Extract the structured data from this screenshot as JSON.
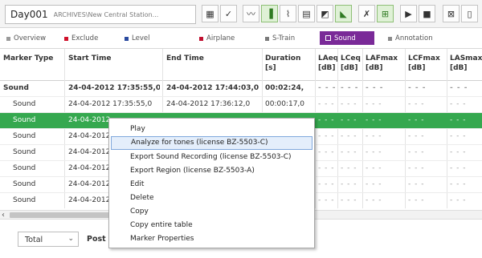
{
  "header": {
    "project_name": "Day001",
    "project_path": "ARCHIVES\\New Central Station...",
    "tools_left": [
      "bookmark-add-icon",
      "filter-check-icon"
    ],
    "tools_mid": [
      "chart-line-icon",
      "chart-bar-icon",
      "chart-mixed-icon",
      "table-icon",
      "map-icon",
      "chart-area-icon"
    ],
    "tools_right": [
      "event-icon",
      "grid-icon"
    ],
    "tools_playback": [
      "play-icon",
      "stop-icon"
    ],
    "tools_end": [
      "window-icon",
      "panel-icon"
    ]
  },
  "filters": [
    {
      "label": "Overview",
      "color": "#9a9a9a"
    },
    {
      "label": "Exclude",
      "color": "#d0112b"
    },
    {
      "label": "Level",
      "color": "#2a4a9f"
    },
    {
      "label": "Airplane",
      "color": "#c01030"
    },
    {
      "label": "S-Train",
      "color": "#7a7a7a"
    },
    {
      "label": "Sound",
      "color": "#7a2a98"
    },
    {
      "label": "Annotation",
      "color": "#8a8a8a"
    }
  ],
  "table": {
    "columns": [
      {
        "label": "Marker Type",
        "unit": ""
      },
      {
        "label": "Start Time",
        "unit": ""
      },
      {
        "label": "End Time",
        "unit": ""
      },
      {
        "label": "Duration",
        "unit": "[s]"
      },
      {
        "label": "LAeq",
        "unit": "[dB]"
      },
      {
        "label": "LCeq",
        "unit": "[dB]"
      },
      {
        "label": "LAFmax",
        "unit": "[dB]"
      },
      {
        "label": "LCFmax",
        "unit": "[dB]"
      },
      {
        "label": "LASmax",
        "unit": "[dB]"
      }
    ],
    "rows": [
      {
        "type": "Sound",
        "start": "24-04-2012 17:35:55,0",
        "end": "24-04-2012 17:44:03,0",
        "duration": "00:02:24,",
        "laeq": "- - -",
        "lceq": "- - -",
        "lafmax": "- - -",
        "lcfmax": "- - -",
        "lasmax": "- - -"
      },
      {
        "type": "Sound",
        "start": "24-04-2012 17:35:55,0",
        "end": "24-04-2012 17:36:12,0",
        "duration": "00:00:17,0",
        "laeq": "- - -",
        "lceq": "- - -",
        "lafmax": "- - -",
        "lcfmax": "- - -",
        "lasmax": "- - -"
      },
      {
        "type": "Sound",
        "start": "24-04-2012",
        "end": "",
        "duration": "",
        "laeq": "- - -",
        "lceq": "- - -",
        "lafmax": "- - -",
        "lcfmax": "- - -",
        "lasmax": "- - -"
      },
      {
        "type": "Sound",
        "start": "24-04-2012",
        "end": "",
        "duration": "",
        "laeq": "- - -",
        "lceq": "- - -",
        "lafmax": "- - -",
        "lcfmax": "- - -",
        "lasmax": "- - -"
      },
      {
        "type": "Sound",
        "start": "24-04-2012",
        "end": "",
        "duration": "",
        "laeq": "- - -",
        "lceq": "- - -",
        "lafmax": "- - -",
        "lcfmax": "- - -",
        "lasmax": "- - -"
      },
      {
        "type": "Sound",
        "start": "24-04-2012",
        "end": "",
        "duration": "",
        "laeq": "- - -",
        "lceq": "- - -",
        "lafmax": "- - -",
        "lcfmax": "- - -",
        "lasmax": "- - -"
      },
      {
        "type": "Sound",
        "start": "24-04-2012",
        "end": "",
        "duration": "",
        "laeq": "- - -",
        "lceq": "- - -",
        "lafmax": "- - -",
        "lcfmax": "- - -",
        "lasmax": "- - -"
      },
      {
        "type": "Sound",
        "start": "24-04-2012",
        "end": "",
        "duration": "",
        "laeq": "- - -",
        "lceq": "- - -",
        "lafmax": "- - -",
        "lcfmax": "- - -",
        "lasmax": "- - -"
      }
    ]
  },
  "context_menu": {
    "items": [
      "Play",
      "Analyze for tones (license BZ-5503-C)",
      "Export Sound Recording (license BZ-5503-C)",
      "Export Region (license BZ-5503-A)",
      "Edit",
      "Delete",
      "Copy",
      "Copy entire table",
      "Marker Properties"
    ]
  },
  "footer": {
    "select_value": "Total",
    "label": "Post W"
  }
}
